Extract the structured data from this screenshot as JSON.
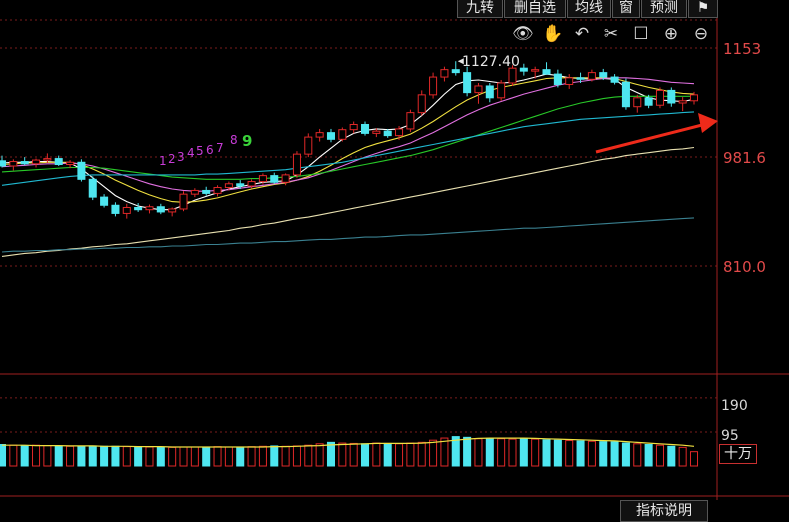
{
  "toolbar": {
    "tabs": [
      "九转",
      "删自选",
      "均线",
      "窗",
      "预测"
    ],
    "icons": [
      "eye-icon",
      "hand-icon",
      "undo-icon",
      "scissors-icon",
      "lock-icon",
      "zoom-in-icon",
      "zoom-out-icon"
    ]
  },
  "colors": {
    "up": "#e02828",
    "down": "#4ee6f0",
    "bg": "#000000",
    "grid": "#7a1d1d"
  },
  "chart_data": {
    "type": "candlestick",
    "price_axis": {
      "ticks": [
        1153,
        981.6,
        810.0
      ],
      "tick_labels": [
        "1153",
        "981.6",
        "810.0"
      ],
      "ylim": [
        708,
        1210
      ]
    },
    "peak_annotation": "1127.40",
    "sequence_labels": [
      "1",
      "2",
      "3",
      "4",
      "5",
      "6",
      "7",
      "8",
      "9"
    ],
    "candles": [
      {
        "o": 993,
        "h": 1000,
        "l": 984,
        "c": 986
      },
      {
        "o": 986,
        "h": 995,
        "l": 980,
        "c": 992
      },
      {
        "o": 992,
        "h": 998,
        "l": 987,
        "c": 989
      },
      {
        "o": 989,
        "h": 996,
        "l": 984,
        "c": 994
      },
      {
        "o": 994,
        "h": 1003,
        "l": 990,
        "c": 996
      },
      {
        "o": 996,
        "h": 1000,
        "l": 986,
        "c": 988
      },
      {
        "o": 988,
        "h": 994,
        "l": 983,
        "c": 991
      },
      {
        "o": 991,
        "h": 995,
        "l": 965,
        "c": 968
      },
      {
        "o": 968,
        "h": 972,
        "l": 940,
        "c": 944
      },
      {
        "o": 944,
        "h": 948,
        "l": 930,
        "c": 933
      },
      {
        "o": 933,
        "h": 937,
        "l": 918,
        "c": 922
      },
      {
        "o": 922,
        "h": 935,
        "l": 915,
        "c": 930
      },
      {
        "o": 930,
        "h": 936,
        "l": 924,
        "c": 927
      },
      {
        "o": 927,
        "h": 934,
        "l": 922,
        "c": 931
      },
      {
        "o": 931,
        "h": 935,
        "l": 921,
        "c": 924
      },
      {
        "o": 924,
        "h": 930,
        "l": 918,
        "c": 928
      },
      {
        "o": 928,
        "h": 952,
        "l": 925,
        "c": 948
      },
      {
        "o": 948,
        "h": 956,
        "l": 944,
        "c": 953
      },
      {
        "o": 953,
        "h": 958,
        "l": 946,
        "c": 949
      },
      {
        "o": 949,
        "h": 960,
        "l": 945,
        "c": 957
      },
      {
        "o": 957,
        "h": 965,
        "l": 953,
        "c": 962
      },
      {
        "o": 962,
        "h": 967,
        "l": 955,
        "c": 959
      },
      {
        "o": 959,
        "h": 968,
        "l": 956,
        "c": 965
      },
      {
        "o": 965,
        "h": 976,
        "l": 961,
        "c": 973
      },
      {
        "o": 973,
        "h": 977,
        "l": 962,
        "c": 964
      },
      {
        "o": 964,
        "h": 976,
        "l": 960,
        "c": 974
      },
      {
        "o": 974,
        "h": 1006,
        "l": 970,
        "c": 1002
      },
      {
        "o": 1002,
        "h": 1030,
        "l": 998,
        "c": 1025
      },
      {
        "o": 1025,
        "h": 1036,
        "l": 1019,
        "c": 1031
      },
      {
        "o": 1031,
        "h": 1036,
        "l": 1018,
        "c": 1022
      },
      {
        "o": 1022,
        "h": 1038,
        "l": 1019,
        "c": 1035
      },
      {
        "o": 1035,
        "h": 1046,
        "l": 1030,
        "c": 1042
      },
      {
        "o": 1042,
        "h": 1046,
        "l": 1027,
        "c": 1030
      },
      {
        "o": 1030,
        "h": 1037,
        "l": 1025,
        "c": 1033
      },
      {
        "o": 1033,
        "h": 1036,
        "l": 1024,
        "c": 1027
      },
      {
        "o": 1027,
        "h": 1040,
        "l": 1021,
        "c": 1036
      },
      {
        "o": 1036,
        "h": 1062,
        "l": 1032,
        "c": 1058
      },
      {
        "o": 1058,
        "h": 1088,
        "l": 1054,
        "c": 1082
      },
      {
        "o": 1082,
        "h": 1112,
        "l": 1077,
        "c": 1106
      },
      {
        "o": 1106,
        "h": 1120,
        "l": 1100,
        "c": 1116
      },
      {
        "o": 1116,
        "h": 1127.4,
        "l": 1108,
        "c": 1112
      },
      {
        "o": 1112,
        "h": 1120,
        "l": 1080,
        "c": 1085
      },
      {
        "o": 1085,
        "h": 1098,
        "l": 1070,
        "c": 1094
      },
      {
        "o": 1094,
        "h": 1098,
        "l": 1072,
        "c": 1078
      },
      {
        "o": 1078,
        "h": 1102,
        "l": 1074,
        "c": 1098
      },
      {
        "o": 1098,
        "h": 1122,
        "l": 1094,
        "c": 1118
      },
      {
        "o": 1118,
        "h": 1124,
        "l": 1108,
        "c": 1114
      },
      {
        "o": 1114,
        "h": 1120,
        "l": 1104,
        "c": 1116
      },
      {
        "o": 1116,
        "h": 1126,
        "l": 1109,
        "c": 1110
      },
      {
        "o": 1110,
        "h": 1116,
        "l": 1092,
        "c": 1096
      },
      {
        "o": 1096,
        "h": 1110,
        "l": 1090,
        "c": 1105
      },
      {
        "o": 1105,
        "h": 1112,
        "l": 1098,
        "c": 1103
      },
      {
        "o": 1103,
        "h": 1116,
        "l": 1100,
        "c": 1112
      },
      {
        "o": 1112,
        "h": 1117,
        "l": 1102,
        "c": 1106
      },
      {
        "o": 1106,
        "h": 1110,
        "l": 1096,
        "c": 1099
      },
      {
        "o": 1099,
        "h": 1104,
        "l": 1062,
        "c": 1066
      },
      {
        "o": 1066,
        "h": 1082,
        "l": 1058,
        "c": 1078
      },
      {
        "o": 1078,
        "h": 1082,
        "l": 1064,
        "c": 1068
      },
      {
        "o": 1068,
        "h": 1092,
        "l": 1064,
        "c": 1088
      },
      {
        "o": 1088,
        "h": 1092,
        "l": 1066,
        "c": 1071
      },
      {
        "o": 1071,
        "h": 1079,
        "l": 1060,
        "c": 1074
      },
      {
        "o": 1074,
        "h": 1086,
        "l": 1069,
        "c": 1082
      }
    ],
    "ma_lines": [
      {
        "color": "#ffffff",
        "values": [
          990,
          991,
          991,
          992,
          992,
          991,
          990,
          982,
          970,
          958,
          946,
          938,
          932,
          929,
          927,
          927,
          933,
          940,
          945,
          950,
          955,
          958,
          961,
          964,
          965,
          966,
          974,
          985,
          998,
          1010,
          1022,
          1030,
          1034,
          1036,
          1035,
          1036,
          1042,
          1054,
          1068,
          1083,
          1096,
          1101,
          1102,
          1100,
          1098,
          1099,
          1102,
          1106,
          1110,
          1108,
          1105,
          1104,
          1103,
          1104,
          1103,
          1092,
          1085,
          1078,
          1075,
          1074,
          1073,
          1076
        ]
      },
      {
        "color": "#f0e040",
        "values": [
          988,
          989,
          990,
          990,
          991,
          991,
          991,
          988,
          982,
          975,
          967,
          960,
          953,
          947,
          942,
          938,
          937,
          938,
          940,
          943,
          947,
          951,
          955,
          958,
          961,
          963,
          967,
          972,
          979,
          987,
          996,
          1004,
          1011,
          1016,
          1020,
          1024,
          1029,
          1037,
          1046,
          1056,
          1066,
          1075,
          1082,
          1088,
          1092,
          1095,
          1098,
          1101,
          1104,
          1105,
          1105,
          1105,
          1105,
          1105,
          1104,
          1100,
          1096,
          1092,
          1089,
          1086,
          1084,
          1083
        ]
      },
      {
        "color": "#e070e0",
        "values": [
          985,
          986,
          987,
          988,
          989,
          989,
          990,
          989,
          986,
          982,
          977,
          972,
          967,
          962,
          958,
          955,
          953,
          952,
          952,
          953,
          954,
          956,
          958,
          960,
          962,
          964,
          967,
          970,
          975,
          980,
          986,
          992,
          998,
          1003,
          1008,
          1012,
          1017,
          1024,
          1031,
          1039,
          1047,
          1055,
          1062,
          1068,
          1073,
          1078,
          1083,
          1087,
          1091,
          1095,
          1098,
          1100,
          1102,
          1104,
          1105,
          1105,
          1104,
          1103,
          1101,
          1099,
          1098,
          1097
        ]
      },
      {
        "color": "#28c828",
        "values": [
          978,
          979,
          980,
          981,
          982,
          983,
          984,
          984,
          984,
          983,
          981,
          979,
          977,
          975,
          973,
          971,
          970,
          969,
          968,
          968,
          968,
          968,
          969,
          969,
          970,
          971,
          972,
          974,
          976,
          979,
          982,
          985,
          988,
          991,
          994,
          997,
          1000,
          1004,
          1008,
          1013,
          1018,
          1023,
          1028,
          1033,
          1038,
          1043,
          1048,
          1053,
          1058,
          1063,
          1067,
          1071,
          1074,
          1077,
          1079,
          1080,
          1080,
          1080,
          1080,
          1080,
          1080,
          1080
        ]
      },
      {
        "color": "#20b8d0",
        "values": [
          960,
          962,
          964,
          966,
          968,
          970,
          972,
          973,
          974,
          974,
          974,
          974,
          974,
          974,
          974,
          974,
          974,
          974,
          975,
          975,
          976,
          977,
          978,
          979,
          980,
          981,
          983,
          985,
          987,
          989,
          991,
          994,
          997,
          1000,
          1003,
          1006,
          1009,
          1012,
          1015,
          1018,
          1021,
          1024,
          1027,
          1030,
          1033,
          1036,
          1039,
          1041,
          1043,
          1045,
          1047,
          1049,
          1050,
          1051,
          1052,
          1053,
          1054,
          1055,
          1056,
          1057,
          1058,
          1059
        ]
      },
      {
        "color": "#e8e0b0",
        "values": [
          864,
          866,
          868,
          869,
          871,
          872,
          874,
          875,
          877,
          878,
          880,
          881,
          883,
          885,
          887,
          889,
          891,
          893,
          895,
          897,
          899,
          902,
          904,
          907,
          909,
          912,
          915,
          917,
          920,
          923,
          926,
          929,
          932,
          935,
          938,
          941,
          944,
          947,
          950,
          953,
          956,
          959,
          962,
          965,
          968,
          971,
          974,
          977,
          980,
          983,
          986,
          989,
          992,
          995,
          997,
          1000,
          1002,
          1004,
          1006,
          1008,
          1009,
          1011
        ]
      },
      {
        "color": "#3a8090",
        "values": [
          870,
          871,
          871,
          872,
          872,
          873,
          873,
          874,
          874,
          875,
          875,
          876,
          876,
          877,
          877,
          878,
          878,
          879,
          880,
          880,
          881,
          882,
          882,
          883,
          884,
          884,
          885,
          886,
          887,
          887,
          888,
          889,
          890,
          890,
          891,
          892,
          893,
          893,
          894,
          895,
          896,
          897,
          898,
          899,
          900,
          901,
          902,
          902,
          903,
          904,
          905,
          906,
          907,
          908,
          909,
          910,
          911,
          912,
          913,
          914,
          915,
          916
        ]
      }
    ],
    "volume_axis": {
      "ticks": [
        190,
        95
      ],
      "tick_labels": [
        "190",
        "95"
      ],
      "unit": "十万",
      "ylim": [
        0,
        240
      ]
    },
    "volume": [
      60,
      58,
      57,
      58,
      57,
      56,
      55,
      55,
      56,
      55,
      55,
      54,
      54,
      53,
      53,
      52,
      53,
      53,
      52,
      54,
      53,
      52,
      54,
      55,
      56,
      55,
      56,
      58,
      62,
      66,
      64,
      63,
      62,
      64,
      63,
      62,
      64,
      66,
      72,
      78,
      82,
      80,
      76,
      77,
      76,
      75,
      77,
      75,
      73,
      72,
      71,
      70,
      69,
      68,
      67,
      64,
      62,
      60,
      58,
      55,
      52,
      40
    ],
    "volume_ma": [
      58,
      58,
      58,
      57,
      57,
      57,
      56,
      56,
      56,
      55,
      55,
      55,
      54,
      54,
      54,
      53,
      53,
      53,
      53,
      53,
      53,
      53,
      53,
      53,
      54,
      54,
      55,
      56,
      57,
      59,
      60,
      61,
      62,
      63,
      63,
      63,
      63,
      64,
      66,
      69,
      72,
      75,
      77,
      78,
      78,
      78,
      78,
      77,
      76,
      75,
      74,
      73,
      72,
      71,
      70,
      68,
      66,
      64,
      62,
      60,
      58,
      55
    ],
    "indicator_button": "指标说明"
  }
}
